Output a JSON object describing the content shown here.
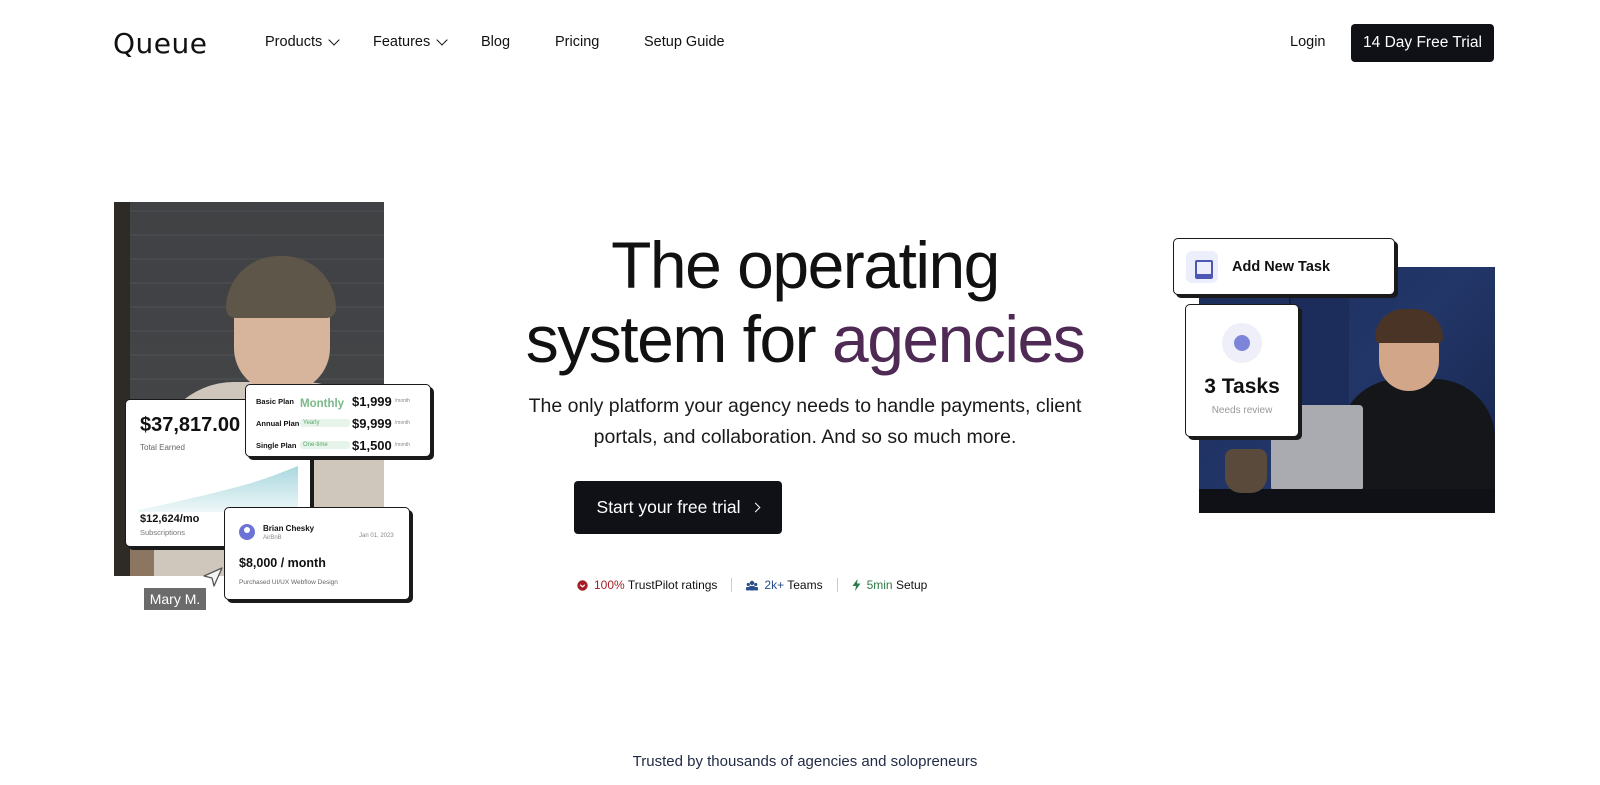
{
  "nav": {
    "logo": "Queue",
    "items": [
      {
        "label": "Products",
        "has_dropdown": true
      },
      {
        "label": "Features",
        "has_dropdown": true
      },
      {
        "label": "Blog",
        "has_dropdown": false
      },
      {
        "label": "Pricing",
        "has_dropdown": false
      },
      {
        "label": "Setup Guide",
        "has_dropdown": false
      }
    ],
    "login": "Login",
    "trial_button": "14 Day Free Trial"
  },
  "hero": {
    "headline_line1": "The operating",
    "headline_line2_plain": "system for ",
    "headline_line2_accent": "agencies",
    "accent_color": "#4e2a55",
    "subtext": "The only platform your agency needs to handle payments, client portals, and collaboration. And so so much more.",
    "cta": "Start your free trial",
    "stats": [
      {
        "icon": "trustpilot-icon",
        "value": "100%",
        "label": "TrustPilot ratings"
      },
      {
        "icon": "teams-icon",
        "value": "2k+",
        "label": "Teams"
      },
      {
        "icon": "lightning-icon",
        "value": "5min",
        "label": "Setup"
      }
    ]
  },
  "left_visual": {
    "earnings": {
      "amount": "$37,817.00",
      "label": "Total Earned",
      "sub_amount": "$12,624/mo",
      "sub_label": "Subscriptions"
    },
    "plans": [
      {
        "name": "Basic Plan",
        "tag": "Monthly",
        "price": "$1,999",
        "per": "/month"
      },
      {
        "name": "Annual Plan",
        "tag": "Yearly",
        "price": "$9,999",
        "per": "/month"
      },
      {
        "name": "Single Plan",
        "tag": "One-time",
        "price": "$1,500",
        "per": "/month"
      }
    ],
    "payment": {
      "name": "Brian Chesky",
      "company": "AirBnB",
      "date": "Jan 01, 2023",
      "amount": "$8,000 / month",
      "description": "Purchased UI/UX Webflow Design"
    },
    "name_tag": "Mary M."
  },
  "right_visual": {
    "add_task": "Add New Task",
    "tasks_count": "3 Tasks",
    "tasks_sub": "Needs review"
  },
  "trusted_text": "Trusted by thousands of agencies and solopreneurs"
}
